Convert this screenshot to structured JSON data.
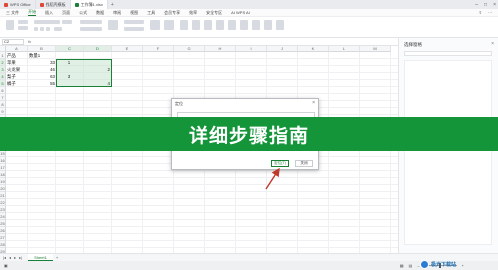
{
  "tabs": [
    {
      "label": "WPS Office",
      "color": "#e0463a"
    },
    {
      "label": "找稻壳模板",
      "color": "#e0463a"
    },
    {
      "label": "工作簿1.xlsx",
      "color": "#1a7f37"
    }
  ],
  "menu": {
    "items": [
      "三 文件",
      "开始",
      "插入",
      "页面",
      "公式",
      "数据",
      "审阅",
      "视图",
      "工具",
      "会员专享",
      "效率",
      "安全专区",
      "AI WPS AI"
    ],
    "active_index": 1
  },
  "formula_bar": {
    "name_box": "C2",
    "fx": "fx"
  },
  "columns": [
    "A",
    "B",
    "C",
    "D",
    "E",
    "F",
    "G",
    "H",
    "I",
    "J",
    "K",
    "L",
    "M"
  ],
  "selected_columns": [
    "C",
    "D"
  ],
  "rows": [
    "1",
    "2",
    "3",
    "4",
    "5",
    "6",
    "7",
    "8",
    "9",
    "10",
    "11",
    "12",
    "13",
    "14",
    "15",
    "16",
    "17",
    "18",
    "19",
    "20",
    "21",
    "22",
    "23",
    "24",
    "25",
    "26",
    "27",
    "28",
    "29"
  ],
  "selected_rows": [
    "2",
    "3",
    "4",
    "5"
  ],
  "cells": {
    "A1": "产品",
    "B1": "数量1",
    "A2": "苹果",
    "B2": "33",
    "C2": "1",
    "A3": "火龙果",
    "B3": "46",
    "D3": "2",
    "A4": "梨子",
    "B4": "63",
    "C4": "3",
    "A5": "橘子",
    "B5": "55",
    "D5": "4"
  },
  "sheet": {
    "tab_label": "Sheet1",
    "add_symbol": "+"
  },
  "pane": {
    "title": "选择窗格"
  },
  "dialog": {
    "title": "定位",
    "ok_label": "定位(T)",
    "cancel_label": "关闭"
  },
  "banner": {
    "text": "详细步骤指南"
  },
  "watermark": {
    "text": "极光下载站"
  },
  "colors": {
    "accent": "#1a7f37",
    "banner": "#14953a",
    "arrow": "#c0392b"
  }
}
